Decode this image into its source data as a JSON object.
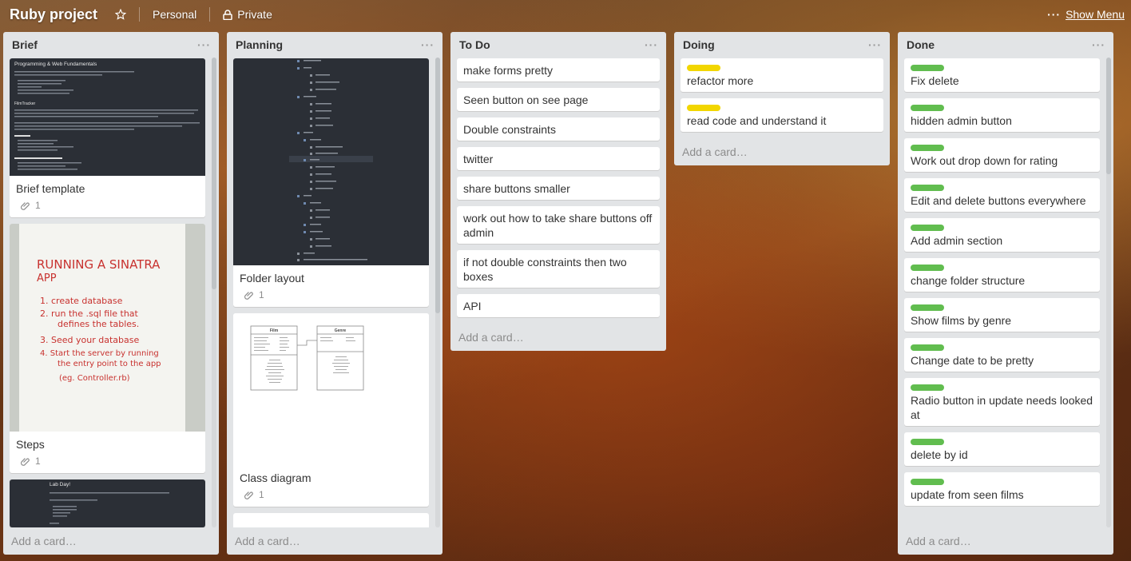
{
  "header": {
    "board_title": "Ruby project",
    "team_label": "Personal",
    "visibility_label": "Private",
    "menu_label": "Show Menu",
    "menu_dots": "···"
  },
  "lists": [
    {
      "title": "Brief",
      "add_card": "Add a card…",
      "cards": [
        {
          "title": "Brief template",
          "attachments": "1",
          "cover": "dark-document"
        },
        {
          "title": "Steps",
          "attachments": "1",
          "cover": "handwritten-note"
        },
        {
          "title": "",
          "cover": "dark-document-lab-day"
        }
      ]
    },
    {
      "title": "Planning",
      "add_card": "Add a card…",
      "cards": [
        {
          "title": "Folder layout",
          "attachments": "1",
          "cover": "folder-tree"
        },
        {
          "title": "Class diagram",
          "attachments": "1",
          "cover": "class-diagram"
        }
      ]
    },
    {
      "title": "To Do",
      "add_card": "Add a card…",
      "cards": [
        {
          "title": "make forms pretty"
        },
        {
          "title": "Seen button on see page"
        },
        {
          "title": "Double constraints"
        },
        {
          "title": "twitter"
        },
        {
          "title": "share buttons smaller"
        },
        {
          "title": "work out how to take share buttons off admin"
        },
        {
          "title": "if not double constraints then two boxes"
        },
        {
          "title": "API"
        }
      ]
    },
    {
      "title": "Doing",
      "add_card": "Add a card…",
      "cards": [
        {
          "title": "refactor more",
          "label": "yellow"
        },
        {
          "title": "read code and understand it",
          "label": "yellow"
        }
      ]
    },
    {
      "title": "Done",
      "add_card": "Add a card…",
      "cards": [
        {
          "title": "Fix delete",
          "label": "green"
        },
        {
          "title": "hidden admin button",
          "label": "green"
        },
        {
          "title": "Work out drop down for rating",
          "label": "green"
        },
        {
          "title": "Edit and delete buttons everywhere",
          "label": "green"
        },
        {
          "title": "Add admin section",
          "label": "green"
        },
        {
          "title": "change folder structure",
          "label": "green"
        },
        {
          "title": "Show films by genre",
          "label": "green"
        },
        {
          "title": "Change date to be pretty",
          "label": "green"
        },
        {
          "title": "Radio button in update needs looked at",
          "label": "green"
        },
        {
          "title": "delete by id",
          "label": "green"
        },
        {
          "title": "update from seen films",
          "label": "green"
        }
      ]
    }
  ],
  "covers": {
    "brief_heading": "Programming & Web Fundamentals",
    "brief_sub": "FilmTracker",
    "lab_heading": "Lab Day!",
    "note_lines": [
      "RUNNING A SINATRA",
      "APP",
      "1.  create database",
      "2.  run the .sql file that",
      "defines the tables.",
      "3.  Seed your database",
      "4.  Start the server by running",
      "the entry point to the app",
      "(eg. Controller.rb)"
    ],
    "diagram_film": "Film",
    "diagram_genre": "Genre"
  },
  "colors": {
    "label_yellow": "#f2d600",
    "label_green": "#61bd4f",
    "list_bg": "#e2e4e6"
  }
}
